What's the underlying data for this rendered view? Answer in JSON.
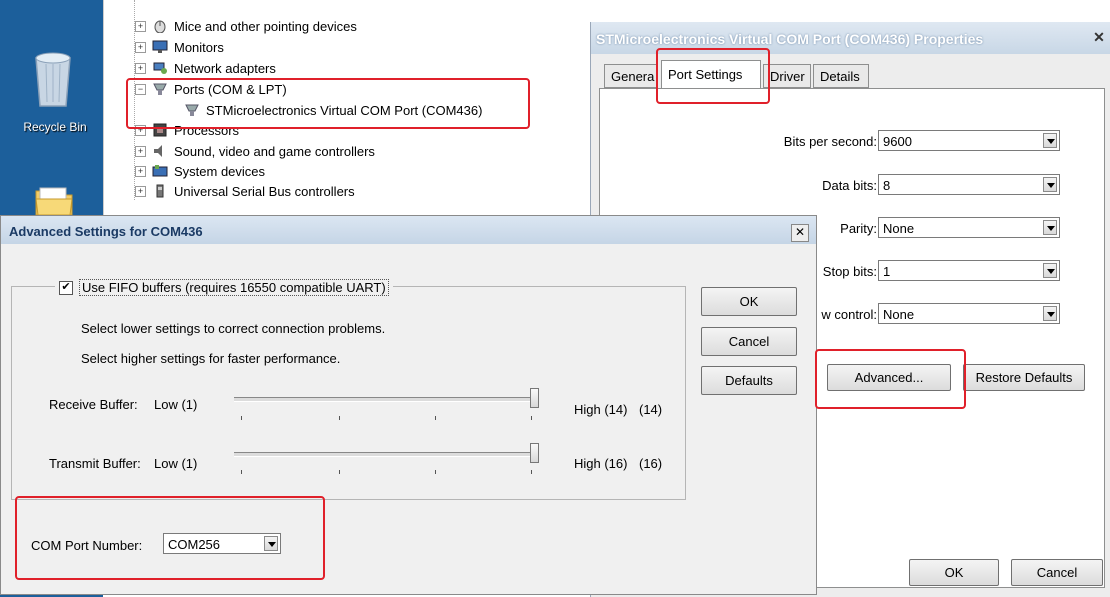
{
  "desktop": {
    "recycle_bin_label": "Recycle Bin"
  },
  "device_tree": {
    "items": [
      {
        "label": "Mice and other pointing devices",
        "expander": "+",
        "icon": "mouse-icon"
      },
      {
        "label": "Monitors",
        "expander": "+",
        "icon": "monitor-icon"
      },
      {
        "label": "Network adapters",
        "expander": "+",
        "icon": "network-icon"
      },
      {
        "label": "Ports (COM & LPT)",
        "expander": "−",
        "icon": "port-icon"
      },
      {
        "label": "STMicroelectronics Virtual COM Port (COM436)",
        "expander": "",
        "icon": "port-icon"
      },
      {
        "label": "Processors",
        "expander": "+",
        "icon": "processor-icon"
      },
      {
        "label": "Sound, video and game controllers",
        "expander": "+",
        "icon": "sound-icon"
      },
      {
        "label": "System devices",
        "expander": "+",
        "icon": "system-icon"
      },
      {
        "label": "Universal Serial Bus controllers",
        "expander": "+",
        "icon": "usb-icon"
      }
    ]
  },
  "properties_dialog": {
    "title": "STMicroelectronics Virtual COM Port (COM436) Properties",
    "close_glyph": "✕",
    "tabs": [
      "Genera",
      "Port Settings",
      "Driver",
      "Details"
    ],
    "fields": {
      "bits_per_second": {
        "label": "Bits per second:",
        "value": "9600"
      },
      "data_bits": {
        "label": "Data bits:",
        "value": "8"
      },
      "parity": {
        "label": "Parity:",
        "value": "None"
      },
      "stop_bits": {
        "label": "Stop bits:",
        "value": "1"
      },
      "flow_control": {
        "label": "w control:",
        "value": "None"
      }
    },
    "advanced_button": "Advanced...",
    "restore_defaults_button": "Restore Defaults",
    "ok_button": "OK",
    "cancel_button": "Cancel"
  },
  "advanced_dialog": {
    "title": "Advanced Settings for COM436",
    "close_glyph": "✕",
    "fifo_checkbox": {
      "checked": true,
      "label": "Use FIFO buffers (requires 16550 compatible UART)"
    },
    "hint_lower": "Select lower settings to correct connection problems.",
    "hint_higher": "Select higher settings for faster performance.",
    "receive_buffer": {
      "label": "Receive Buffer:",
      "low": "Low (1)",
      "high": "High (14)",
      "value_text": "(14)",
      "level": 1.0
    },
    "transmit_buffer": {
      "label": "Transmit Buffer:",
      "low": "Low (1)",
      "high": "High (16)",
      "value_text": "(16)",
      "level": 1.0
    },
    "com_port": {
      "label": "COM Port Number:",
      "value": "COM256"
    },
    "ok_button": "OK",
    "cancel_button": "Cancel",
    "defaults_button": "Defaults"
  },
  "colors": {
    "highlight": "#e0202a",
    "desktop": "#1c5f9b",
    "dialog_bg": "#f0f0f0"
  }
}
